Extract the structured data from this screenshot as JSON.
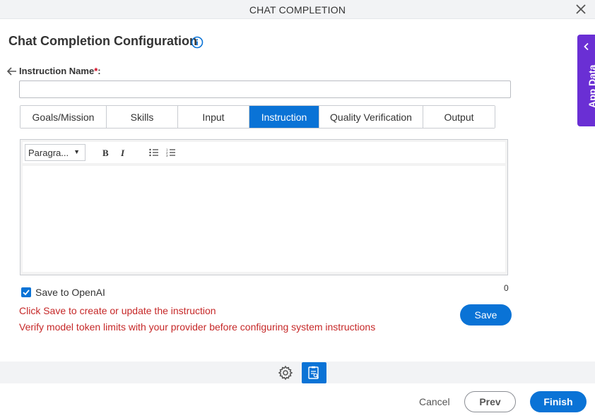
{
  "window": {
    "title": "CHAT COMPLETION",
    "close_icon": "close-icon"
  },
  "header": {
    "title": "Chat Completion Configuration",
    "info_icon": "info-icon"
  },
  "instruction_name": {
    "label": "Instruction Name",
    "required_mark": "*",
    "colon": ":",
    "value": "",
    "back_icon": "arrow-left-icon"
  },
  "tabs": [
    {
      "label": "Goals/Mission",
      "active": false
    },
    {
      "label": "Skills",
      "active": false
    },
    {
      "label": "Input",
      "active": false
    },
    {
      "label": "Instruction",
      "active": true
    },
    {
      "label": "Quality Verification",
      "active": false
    },
    {
      "label": "Output",
      "active": false
    }
  ],
  "editor": {
    "paragraph_select": "Paragra...",
    "bold_label": "B",
    "italic_label": "I",
    "bullet_list_icon": "bullet-list-icon",
    "numbered_list_icon": "numbered-list-icon",
    "content": "",
    "char_count": "0"
  },
  "save_to_openai": {
    "label": "Save to OpenAI",
    "checked": true
  },
  "messages": [
    "Click Save to create or update the instruction",
    "Verify model token limits with your provider before configuring system instructions"
  ],
  "save_button": "Save",
  "footer": {
    "cancel": "Cancel",
    "prev": "Prev",
    "finish": "Finish",
    "gear_icon": "gear-icon",
    "doc_icon": "document-icon"
  },
  "side_panel": {
    "label": "App Data",
    "icon": "chevron-left-icon"
  },
  "colors": {
    "accent": "#0a73d6",
    "error_text": "#c62828",
    "side_panel": "#6a2fd4",
    "required": "#d0021b"
  }
}
